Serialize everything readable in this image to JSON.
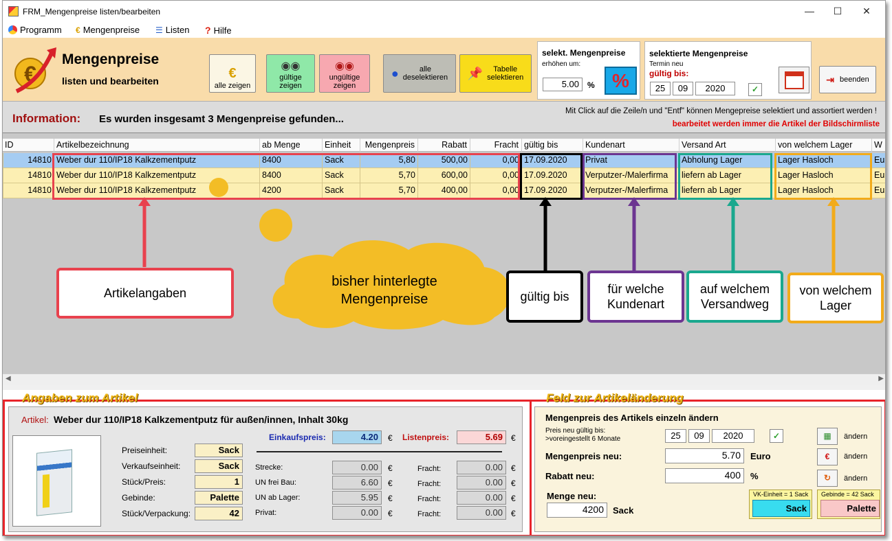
{
  "window": {
    "title": "FRM_Mengenpreise listen/bearbeiten",
    "minimize": "—",
    "maximize": "☐",
    "close": "✕"
  },
  "menu": [
    {
      "label": "Programm",
      "icon": "program-icon"
    },
    {
      "label": "Mengenpreise",
      "icon": "euro-icon"
    },
    {
      "label": "Listen",
      "icon": "list-icon"
    },
    {
      "label": "Hilfe",
      "icon": "help-icon"
    }
  ],
  "header": {
    "title": "Mengenpreise",
    "subtitle": "listen und bearbeiten"
  },
  "toolbar": {
    "alle_zeigen": "alle zeigen",
    "gueltige_1": "gültige",
    "gueltige_2": "zeigen",
    "ungueltige_1": "ungültige",
    "ungueltige_2": "zeigen",
    "deselect_1": "alle",
    "deselect_2": "deselektieren",
    "tabselect_1": "Tabelle",
    "tabselect_2": "selektieren",
    "beenden": "beenden",
    "colors": {
      "gueltige": "#8fe8a8",
      "ungueltige": "#f7a8b0",
      "deselect": "#bdbdb5",
      "tabselect": "#f8dc1a",
      "percent": "#18a8e8"
    }
  },
  "raise_box": {
    "title": "selekt. Mengenpreise",
    "label": "erhöhen um:",
    "value": "5.00",
    "unit": "%",
    "percent_symbol": "%"
  },
  "termin_box": {
    "title": "selektierte Mengenpreise",
    "label": "Termin neu",
    "valid_label": "gültig bis:",
    "day": "25",
    "month": "09",
    "year": "2020"
  },
  "info": {
    "label": "Information:",
    "message": "Es wurden insgesamt 3 Mengenpreise gefunden...",
    "hint": "Mit Click auf die Zeile/n und \"Entf\" können Mengepreise selektiert und assortiert werden !",
    "warning": "bearbeitet werden immer die Artikel der Bildschirmliste"
  },
  "table": {
    "columns": [
      "ID",
      "Artikelbezeichnung",
      "ab Menge",
      "Einheit",
      "Mengenpreis",
      "Rabatt",
      "Fracht",
      "gültig bis",
      "Kundenart",
      "Versand Art",
      "von welchem Lager",
      "W"
    ],
    "rows": [
      [
        "14810",
        "Weber dur 110/IP18  Kalkzementputz",
        "8400",
        "Sack",
        "5,80",
        "500,00",
        "0,00",
        "17.09.2020",
        "Privat",
        "Abholung Lager",
        "Lager Hasloch",
        "Eu"
      ],
      [
        "14810",
        "Weber dur 110/IP18  Kalkzementputz",
        "8400",
        "Sack",
        "5,70",
        "600,00",
        "0,00",
        "17.09.2020",
        "Verputzer-/Malerfirma",
        "liefern ab Lager",
        "Lager Hasloch",
        "Eu"
      ],
      [
        "14810",
        "Weber dur 110/IP18  Kalkzementputz",
        "4200",
        "Sack",
        "5,70",
        "400,00",
        "0,00",
        "17.09.2020",
        "Verputzer-/Malerfirma",
        "liefern ab Lager",
        "Lager Hasloch",
        "Eu"
      ]
    ]
  },
  "annotations": {
    "artikelangaben": "Artikelangaben",
    "cloud_1": "bisher hinterlegte",
    "cloud_2": "Mengenpreise",
    "gueltig": "gültig bis",
    "kunde_1": "für welche",
    "kunde_2": "Kundenart",
    "versand_1": "auf welchem",
    "versand_2": "Versandweg",
    "lager_1": "von welchem",
    "lager_2": "Lager",
    "colors": {
      "red": "#e8424e",
      "black": "#000000",
      "purple": "#6c3591",
      "teal": "#1aa88e",
      "orange": "#f2ab1a",
      "cloud": "#f3bd26"
    }
  },
  "artikel_panel": {
    "section_title": "Angaben zum Artikel",
    "artikel_label": "Artikel:",
    "artikel_name": "Weber dur 110/IP18  Kalkzementputz  für außen/innen, Inhalt 30kg",
    "ek_label": "Einkaufspreis:",
    "ek_value": "4.20",
    "lp_label": "Listenpreis:",
    "lp_value": "5.69",
    "currency": "€",
    "props": [
      {
        "label": "Preiseinheit:",
        "value": "Sack"
      },
      {
        "label": "Verkaufseinheit:",
        "value": "Sack"
      },
      {
        "label": "Stück/Preis:",
        "value": "1"
      },
      {
        "label": "Gebinde:",
        "value": "Palette"
      },
      {
        "label": "Stück/Verpackung:",
        "value": "42"
      }
    ],
    "prices": [
      {
        "label": "Strecke:",
        "value": "0.00",
        "fracht_label": "Fracht:",
        "fracht": "0.00"
      },
      {
        "label": "UN frei Bau:",
        "value": "6.60",
        "fracht_label": "Fracht:",
        "fracht": "0.00"
      },
      {
        "label": "UN ab Lager:",
        "value": "5.95",
        "fracht_label": "Fracht:",
        "fracht": "0.00"
      },
      {
        "label": "Privat:",
        "value": "0.00",
        "fracht_label": "Fracht:",
        "fracht": "0.00"
      }
    ]
  },
  "change_panel": {
    "section_title": "Feld zur Artikeländerung",
    "title": "Mengenpreis des Artikels einzeln ändern",
    "valid_label_1": "Preis neu gültig bis:",
    "valid_label_2": ">voreingestellt 6 Monate",
    "day": "25",
    "month": "09",
    "year": "2020",
    "price_label": "Mengenpreis neu:",
    "price_value": "5.70",
    "price_unit": "Euro",
    "rabatt_label": "Rabatt neu:",
    "rabatt_value": "400",
    "rabatt_unit": "%",
    "menge_label": "Menge neu:",
    "menge_value": "4200",
    "menge_unit": "Sack",
    "aendern": "ändern",
    "vk_caption": "VK-Einheit = 1 Sack",
    "vk_button": "Sack",
    "gebinde_caption": "Gebinde = 42 Sack",
    "gebinde_button": "Palette"
  }
}
